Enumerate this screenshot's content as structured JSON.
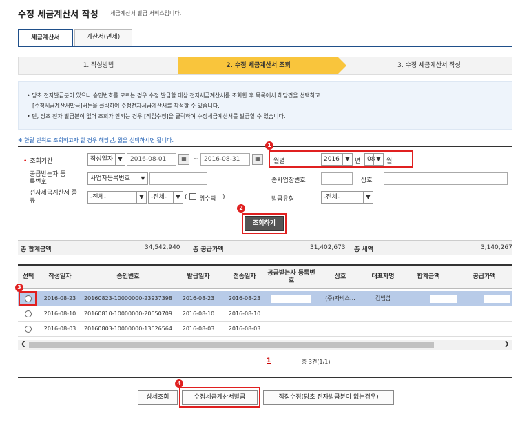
{
  "header": {
    "title": "수정 세금계산서 작성",
    "subtitle": "세금계산서 발급 서비스입니다."
  },
  "tabs": [
    {
      "label": "세금계산서",
      "active": true
    },
    {
      "label": "계산서(면세)",
      "active": false
    }
  ],
  "steps": [
    {
      "label": "1. 작성방법",
      "active": false
    },
    {
      "label": "2. 수정 세금계산서 조회",
      "active": true
    },
    {
      "label": "3. 수정 세금계산서 작성",
      "active": false
    }
  ],
  "info": {
    "line1": "당초 전자발급분이 있으나 승인번호를 모르는 경우 수정 발급할 대상 전자세금계산서를 조회한 후 목록에서 해당건을 선택하고",
    "line2": "[수정세금계산서발급]버튼을 클릭하여 수정전자세금계산서를 작성할 수 있습니다.",
    "line3": "단, 당초 전자 발급분이 없어 조회가 안되는 경우 [직접수정]을 클릭하여 수정세금계산서를 발급할 수 있습니다."
  },
  "notice": "※ 한달 단위로 조회하고자 할 경우 해당년, 월을 선택하시면 됩니다.",
  "search": {
    "period_label": "조회기간",
    "date_type": "작성일자",
    "date_from": "2016-08-01",
    "tilde": "~",
    "date_to": "2016-08-31",
    "monthly_label": "월별",
    "year": "2016",
    "year_suffix": "년",
    "month": "08",
    "month_suffix": "월",
    "recipient_reg_label": "공급받는자 등록번호",
    "recipient_reg_type": "사업자등록번호",
    "branch_label": "종사업장번호",
    "company_label": "상호",
    "type_label": "전자세금계산서 종류",
    "type1": "-전체-",
    "type2": "-전체-",
    "trust_prefix": "(",
    "trust_label": "위수탁",
    "trust_suffix": ")",
    "issue_type_label": "발급유형",
    "issue_type": "-전체-",
    "search_button": "조회하기"
  },
  "badges": [
    "1",
    "2",
    "3",
    "4"
  ],
  "totals": {
    "total_label": "총 합계금액",
    "total_value": "34,542,940",
    "supply_label": "총 공급가액",
    "supply_value": "31,402,673",
    "tax_label": "총 세액",
    "tax_value": "3,140,267"
  },
  "table": {
    "headers": [
      "선택",
      "작성일자",
      "승인번호",
      "발급일자",
      "전송일자",
      "공급받는자 등록번호",
      "상호",
      "대표자명",
      "합계금액",
      "공급가액"
    ],
    "rows": [
      {
        "date": "2016-08-23",
        "approval": "20160823-10000000-23937398",
        "issue": "2016-08-23",
        "send": "2016-08-23",
        "company": "(주)자비스…",
        "ceo": "김범섭",
        "selected": true
      },
      {
        "date": "2016-08-10",
        "approval": "20160810-10000000-20650709",
        "issue": "2016-08-10",
        "send": "2016-08-10",
        "company": "",
        "ceo": "",
        "selected": false
      },
      {
        "date": "2016-08-03",
        "approval": "20160803-10000000-13626564",
        "issue": "2016-08-03",
        "send": "2016-08-03",
        "company": "",
        "ceo": "",
        "selected": false
      }
    ]
  },
  "pagination": {
    "current": "1",
    "count": "총 3건(1/1)"
  },
  "buttons": {
    "detail": "상세조회",
    "issue": "수정세금계산서발급",
    "direct": "직접수정(당초 전자발급분이 없는경우)"
  },
  "colors": {
    "accent": "#f9c53c",
    "highlight": "#e02020",
    "tab_border": "#1f4f8a",
    "selected_row": "#b8cbe8"
  }
}
